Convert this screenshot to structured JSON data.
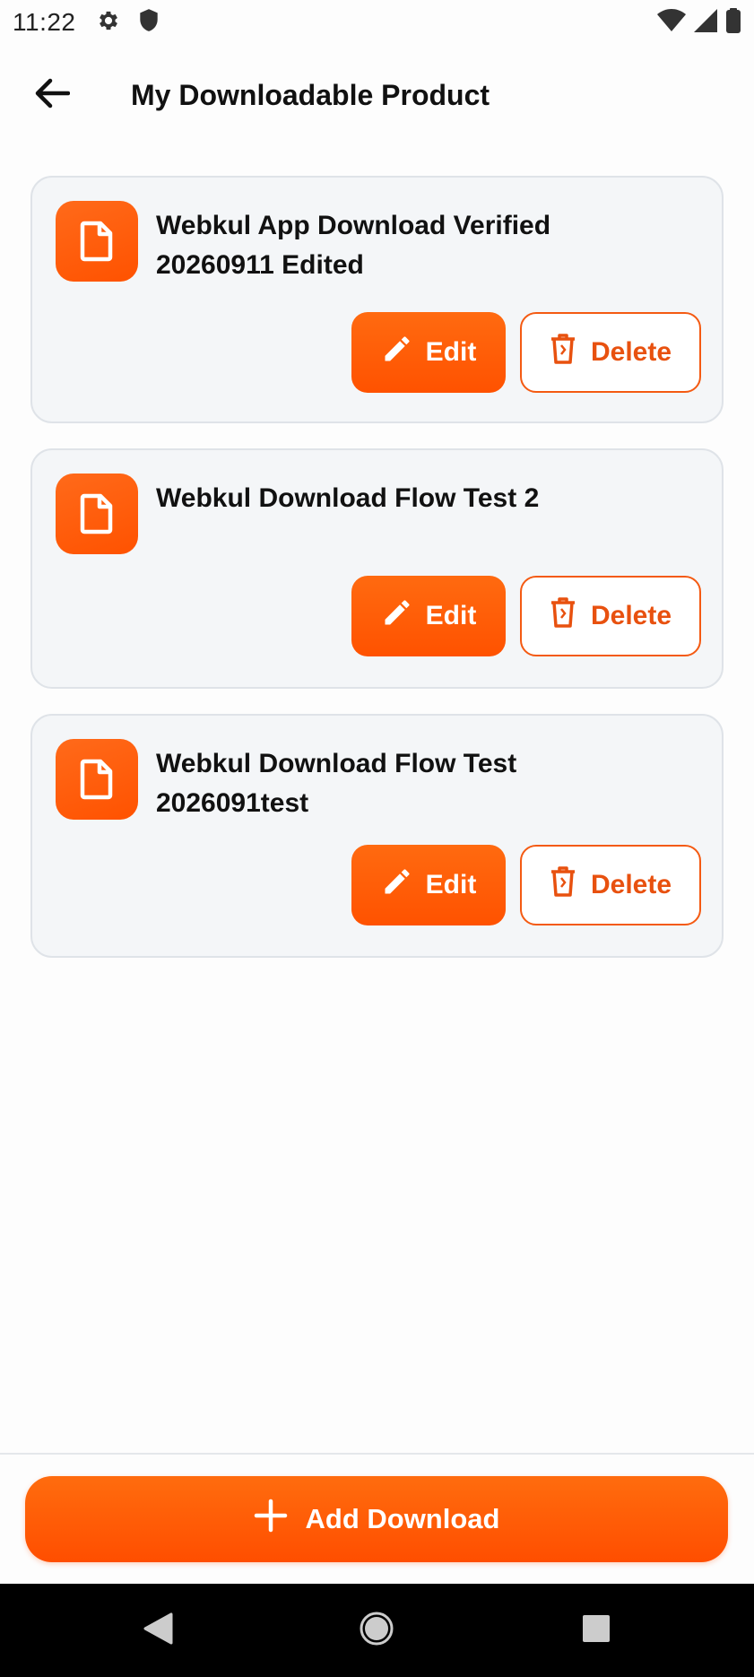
{
  "status_bar": {
    "time": "11:22",
    "left_icons": [
      "gear-icon",
      "shield-icon"
    ],
    "right_icons": [
      "wifi-icon",
      "cell-signal-icon",
      "battery-icon"
    ]
  },
  "app_bar": {
    "title": "My Downloadable Product",
    "back_icon": "arrow-left-icon"
  },
  "products": [
    {
      "title_line1": "Webkul App Download Verified",
      "title_line2": "20260911 Edited",
      "edit_label": "Edit",
      "delete_label": "Delete"
    },
    {
      "title_line1": "Webkul Download Flow Test 2",
      "title_line2": "",
      "edit_label": "Edit",
      "delete_label": "Delete"
    },
    {
      "title_line1": "Webkul Download Flow Test",
      "title_line2": "2026091test",
      "edit_label": "Edit",
      "delete_label": "Delete"
    }
  ],
  "footer": {
    "add_label": "Add Download"
  },
  "colors": {
    "accent": "#ff5a0a",
    "delete_text": "#e8510f",
    "card_bg": "#f4f6f8"
  }
}
